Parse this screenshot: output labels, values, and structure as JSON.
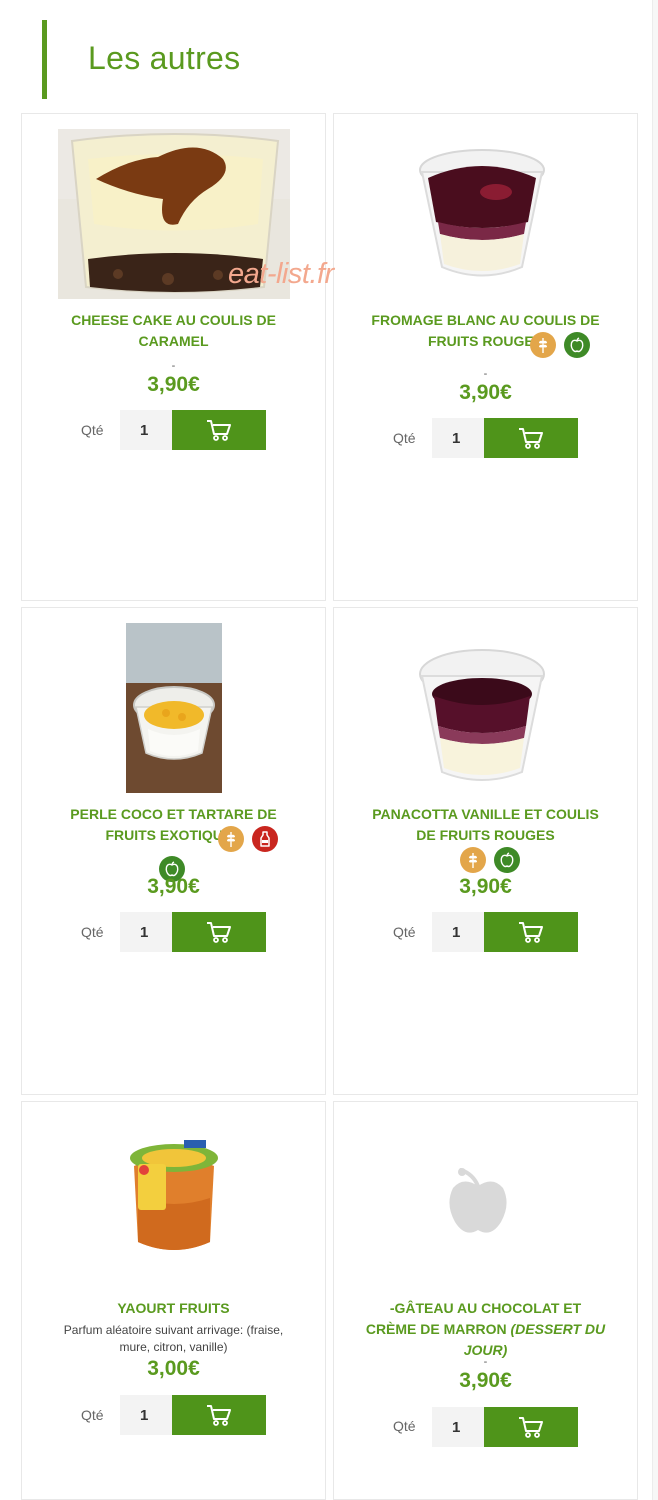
{
  "section": {
    "title": "Les autres"
  },
  "watermark": "eat-list.fr",
  "qty_label": "Qté",
  "qty_default": "1",
  "products": [
    {
      "name": "CHEESE CAKE AU COULIS DE CARAMEL",
      "dash": "-",
      "price": "3,90€",
      "icons": []
    },
    {
      "name": "FROMAGE BLANC AU COULIS DE FRUITS ROUGES",
      "dash": "-",
      "price": "3,90€",
      "icons": [
        "wheat-icon",
        "apple-icon"
      ]
    },
    {
      "name": "PERLE COCO ET TARTARE DE FRUITS EXOTIQUES",
      "price": "3,90€",
      "icons": [
        "wheat-icon",
        "milk-bottle-icon",
        "apple-icon"
      ]
    },
    {
      "name": "PANACOTTA VANILLE ET COULIS DE FRUITS ROUGES",
      "price": "3,90€",
      "icons": [
        "wheat-icon",
        "apple-icon"
      ]
    },
    {
      "name": "YAOURT FRUITS",
      "description": "Parfum aléatoire suivant arrivage: (fraise, mure, citron, vanille)",
      "price": "3,00€",
      "icons": []
    },
    {
      "name": "-GÂTEAU AU CHOCOLAT ET CRÈME DE MARRON",
      "name_italic": "(DESSERT DU JOUR)",
      "dash": "-",
      "price": "3,90€",
      "icons": []
    }
  ],
  "colors": {
    "brand_green": "#5a9a1f",
    "button_green": "#4f941a",
    "gluten_badge": "#e3a64a",
    "fruit_badge": "#3e8a27",
    "milk_badge": "#c9261f"
  }
}
